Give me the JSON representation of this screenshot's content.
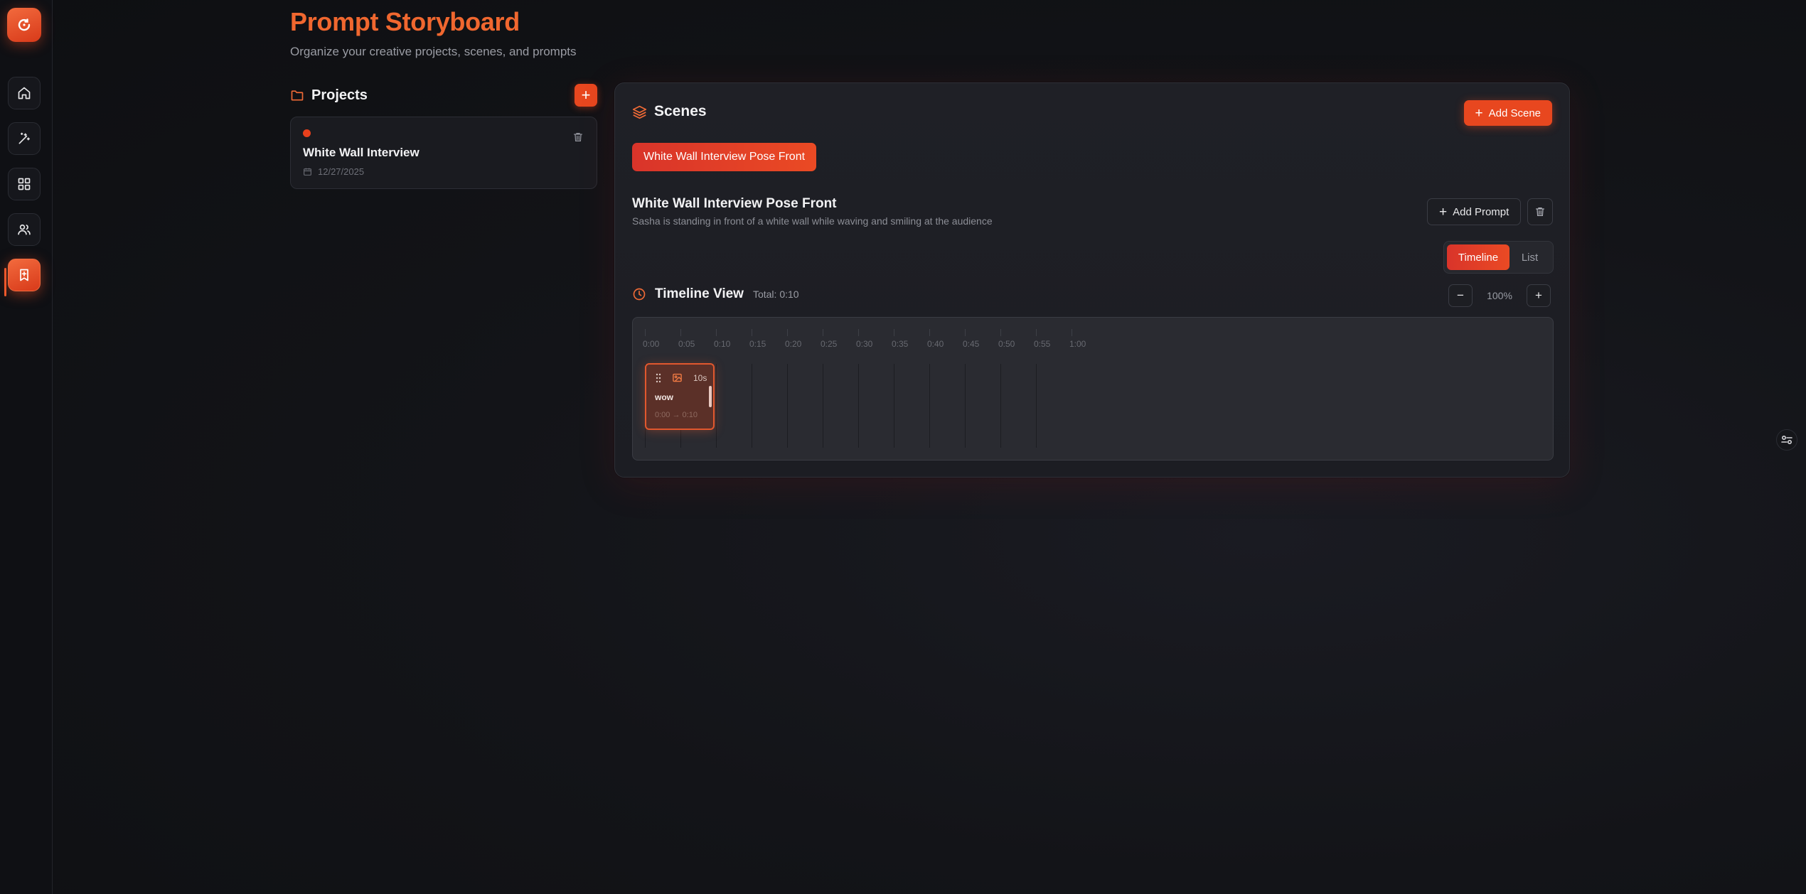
{
  "header": {
    "title": "Prompt Storyboard",
    "subtitle": "Organize your creative projects, scenes, and prompts"
  },
  "sidebar": {
    "items": [
      {
        "icon": "home-icon"
      },
      {
        "icon": "magic-wand-icon"
      },
      {
        "icon": "grid-icon"
      },
      {
        "icon": "users-icon"
      },
      {
        "icon": "bookmark-icon",
        "active": true
      }
    ]
  },
  "projects": {
    "title": "Projects",
    "add_label": "+",
    "items": [
      {
        "name": "White Wall Interview",
        "date": "12/27/2025"
      }
    ]
  },
  "scenes": {
    "title": "Scenes",
    "add_label": "Add Scene",
    "tabs": [
      "White Wall Interview Pose Front"
    ],
    "selected": {
      "title": "White Wall Interview Pose Front",
      "description": "Sasha is standing in front of a white wall while waving and smiling at the audience"
    },
    "add_prompt_label": "Add Prompt",
    "view_toggle": {
      "timeline": "Timeline",
      "list": "List",
      "active": "Timeline"
    }
  },
  "timeline": {
    "title": "Timeline View",
    "total": "Total: 0:10",
    "zoom_out": "−",
    "zoom_in": "+",
    "zoom_level": "100%",
    "ticks": [
      "0:00",
      "0:05",
      "0:10",
      "0:15",
      "0:20",
      "0:25",
      "0:30",
      "0:35",
      "0:40",
      "0:45",
      "0:50",
      "0:55",
      "1:00"
    ],
    "clips": [
      {
        "duration": "10s",
        "label": "wow",
        "range": "0:00 → 0:10"
      }
    ]
  },
  "colors": {
    "accent": "#e8471f",
    "title": "#f0672f"
  }
}
